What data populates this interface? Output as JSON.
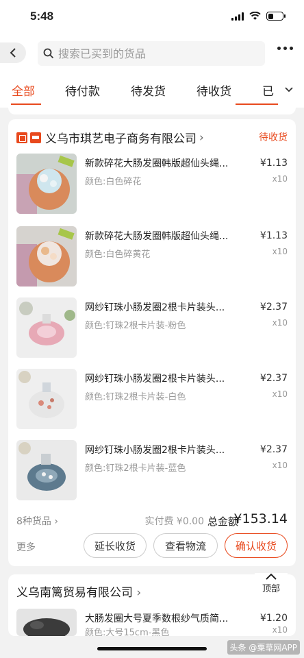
{
  "status_bar": {
    "time": "5:48"
  },
  "search": {
    "placeholder": "搜索已买到的货品"
  },
  "tabs": [
    {
      "label": "全部",
      "active": true
    },
    {
      "label": "待付款",
      "active": false
    },
    {
      "label": "待发货",
      "active": false
    },
    {
      "label": "待收货",
      "active": false
    },
    {
      "label": "已",
      "active": false
    }
  ],
  "order1": {
    "shop_name": "义乌市琪艺电子商务有限公司",
    "status": "待收货",
    "items": [
      {
        "title": "新款碎花大肠发圈韩版超仙头绳...",
        "spec": "颜色:白色碎花",
        "price": "¥1.13",
        "qty": "x10"
      },
      {
        "title": "新款碎花大肠发圈韩版超仙头绳...",
        "spec": "颜色:白色碎黄花",
        "price": "¥1.13",
        "qty": "x10"
      },
      {
        "title": "网纱钉珠小肠发圈2根卡片装头...",
        "spec": "颜色:钉珠2根卡片装-粉色",
        "price": "¥2.37",
        "qty": "x10"
      },
      {
        "title": "网纱钉珠小肠发圈2根卡片装头...",
        "spec": "颜色:钉珠2根卡片装-白色",
        "price": "¥2.37",
        "qty": "x10"
      },
      {
        "title": "网纱钉珠小肠发圈2根卡片装头...",
        "spec": "颜色:钉珠2根卡片装-蓝色",
        "price": "¥2.37",
        "qty": "x10"
      }
    ],
    "summary": {
      "count": "8种货品",
      "shipping": "实付费 ¥0.00",
      "total_label": "总金额",
      "total": "¥153.14"
    },
    "actions": {
      "more": "更多",
      "extend": "延长收货",
      "logistics": "查看物流",
      "confirm": "确认收货"
    }
  },
  "order2": {
    "shop_name": "义乌南篱贸易有限公司",
    "items": [
      {
        "title": "大肠发圈大号夏季数根纱气质简...",
        "spec": "颜色:大号15cm-黑色",
        "price": "¥1.20",
        "qty": "x10"
      }
    ]
  },
  "back_to_top": "顶部",
  "watermark": "头条 @粟草网APP",
  "colors": {
    "accent": "#e8491d"
  }
}
